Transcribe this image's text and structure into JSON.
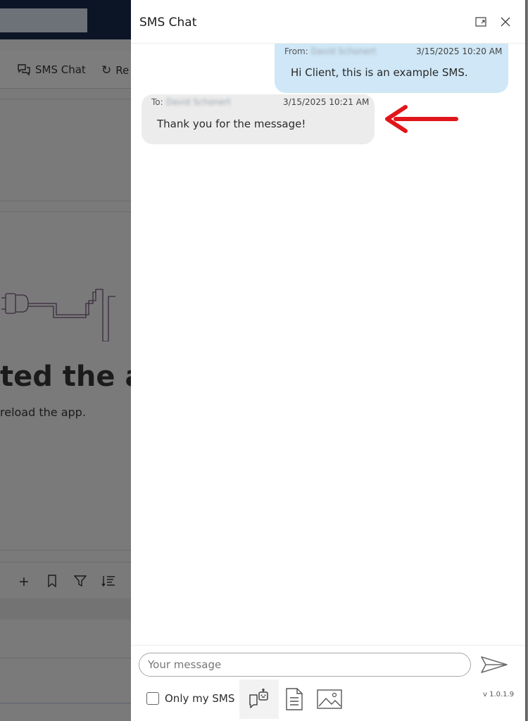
{
  "background_app": {
    "toolbar": {
      "sms_chat_label": "SMS Chat",
      "reload_label": "Re"
    },
    "error_heading": "ted the ap",
    "error_sub": "reload the app."
  },
  "panel": {
    "title": "SMS Chat",
    "messages": [
      {
        "direction": "outgoing",
        "prefix": "From:",
        "name": "David Schonert",
        "time": "3/15/2025 10:20 AM",
        "text": "Hi Client, this is an example SMS."
      },
      {
        "direction": "incoming",
        "prefix": "To:",
        "name": "David Schonert",
        "time": "3/15/2025 10:21 AM",
        "text": "Thank you for the message!"
      }
    ],
    "compose": {
      "placeholder": "Your message",
      "value": "",
      "only_my_sms_label": "Only my SMS",
      "only_my_sms_checked": false,
      "version": "v 1.0.1.9"
    }
  },
  "icons": {
    "expand": "expand-icon",
    "close": "close-icon",
    "send": "send-icon",
    "bot": "bot-chat-icon",
    "document": "document-icon",
    "image": "image-icon",
    "annotation_arrow": "red-arrow-icon"
  },
  "colors": {
    "outgoing_bubble": "#cfe7f6",
    "incoming_bubble": "#ececec",
    "annotation_arrow": "#e0161b"
  }
}
